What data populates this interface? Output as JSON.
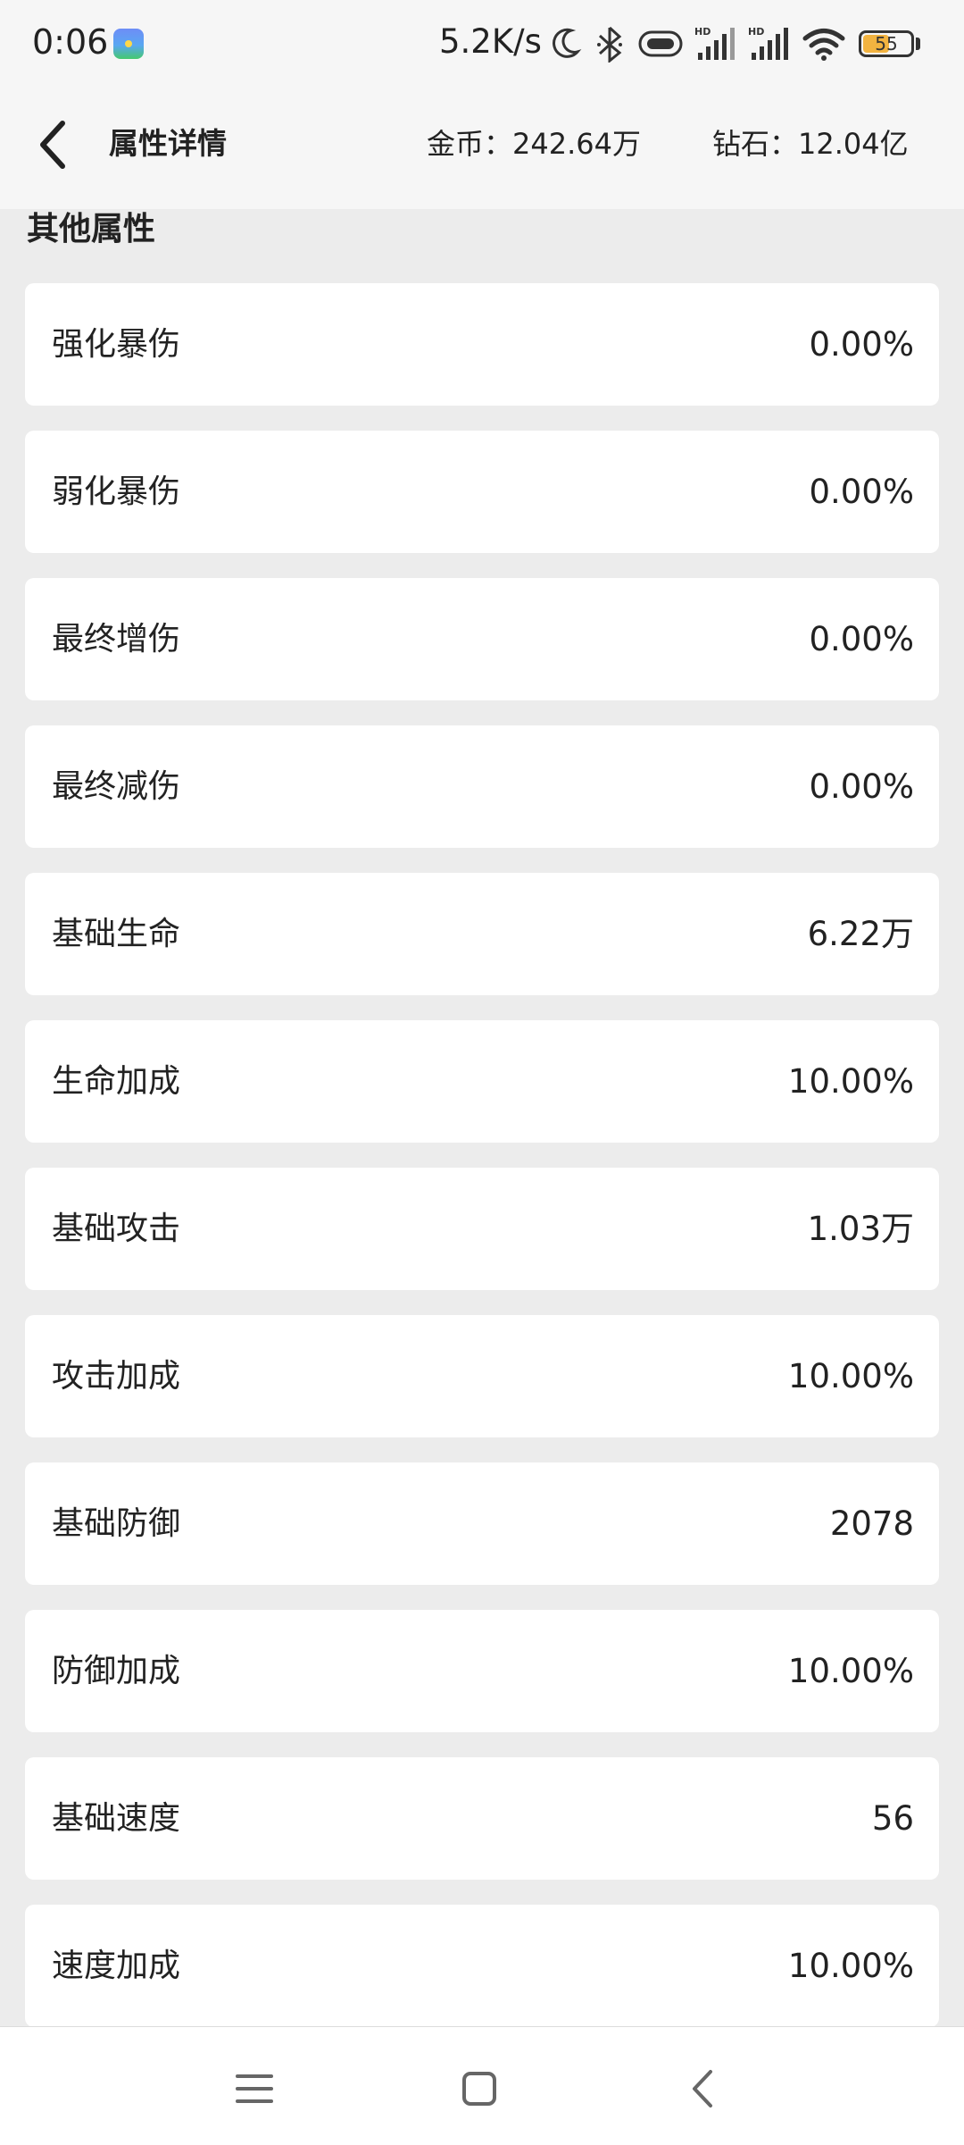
{
  "status_bar": {
    "time": "0:06",
    "network_speed": "5.2K/s",
    "battery_level": 55,
    "battery_label": "55",
    "icons": [
      "moon-icon",
      "bluetooth-icon",
      "vibrate-icon",
      "signal-icon",
      "signal-icon",
      "wifi-icon",
      "battery-icon"
    ]
  },
  "header": {
    "title": "属性详情",
    "gold_label": "金币：",
    "gold_value": "242.64万",
    "diamond_label": "钻石：",
    "diamond_value": "12.04亿"
  },
  "section_title": "其他属性",
  "attributes": [
    {
      "label": "强化暴伤",
      "value": "0.00%"
    },
    {
      "label": "弱化暴伤",
      "value": "0.00%"
    },
    {
      "label": "最终增伤",
      "value": "0.00%"
    },
    {
      "label": "最终减伤",
      "value": "0.00%"
    },
    {
      "label": "基础生命",
      "value": "6.22万"
    },
    {
      "label": "生命加成",
      "value": "10.00%"
    },
    {
      "label": "基础攻击",
      "value": "1.03万"
    },
    {
      "label": "攻击加成",
      "value": "10.00%"
    },
    {
      "label": "基础防御",
      "value": "2078"
    },
    {
      "label": "防御加成",
      "value": "10.00%"
    },
    {
      "label": "基础速度",
      "value": "56"
    },
    {
      "label": "速度加成",
      "value": "10.00%"
    }
  ],
  "nav_bar": {
    "icons": [
      "menu-icon",
      "home-icon",
      "back-icon"
    ]
  },
  "colors": {
    "background": "#ececec",
    "header_background": "#f6f6f6",
    "card_background": "#ffffff",
    "text": "#222222",
    "battery": "#f2b340"
  }
}
